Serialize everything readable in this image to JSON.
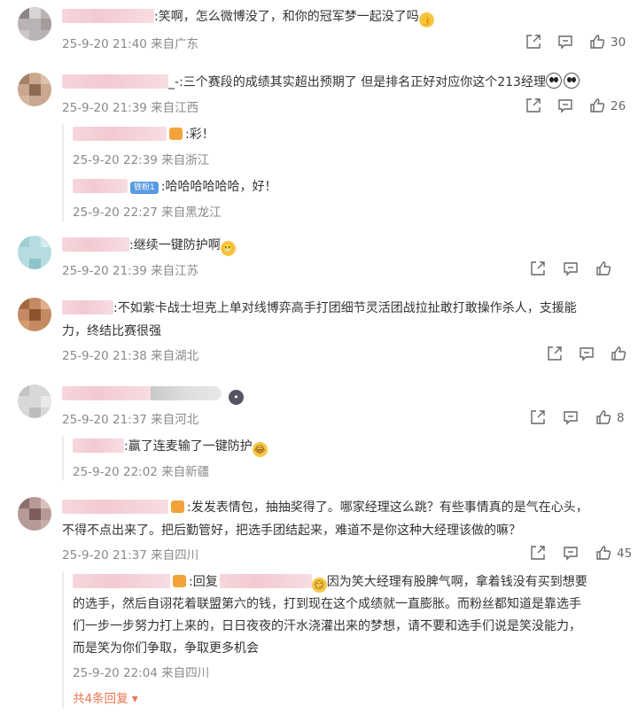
{
  "comments": [
    {
      "text": ":笑啊，怎么微博没了，和你的冠军梦一起没了吗",
      "emoji_icon": "thumbs-up-emoji",
      "meta": "25-9-20 21:40 来自广东",
      "likes": "30"
    },
    {
      "text_prefix": "_-",
      "text": ":三个赛段的成绩其实超出预期了 但是排名正好对应你这个213经理",
      "emoji_icon": "panda-emoji",
      "meta": "25-9-20 21:39 来自江西",
      "likes": "26",
      "replies": [
        {
          "text": ":彩！",
          "meta": "25-9-20 22:39 来自浙江"
        },
        {
          "badge": "铁粉1",
          "text": ":哈哈哈哈哈哈，好！",
          "meta": "25-9-20 22:27 来自黑龙江"
        }
      ]
    },
    {
      "text": ":继续一键防护啊",
      "emoji_icon": "grimace-emoji",
      "meta": "25-9-20 21:39 来自江苏",
      "likes": ""
    },
    {
      "text_line1": ":不如紫卡战士坦克上单对线博弈高手打团细节灵活团战拉扯敢打敢操作杀人，支援能",
      "text_line2": "力，终结比赛很强",
      "meta": "25-9-20 21:38 来自湖北",
      "likes": ""
    },
    {
      "emoji_icon": "sticker-emoji",
      "meta": "25-9-20 21:37 来自河北",
      "likes": "8",
      "replies": [
        {
          "text": ":赢了连麦输了一键防护",
          "meta": "25-9-20 22:02 来自新疆"
        }
      ]
    },
    {
      "text_line1": ":发发表情包，抽抽奖得了。哪家经理这么跳？有些事情真的是气在心头，",
      "text_line2": "不得不点出来了。把后勤管好，把选手团结起来，难道不是你这种大经理该做的嘛？",
      "meta": "25-9-20 21:37 来自四川",
      "likes": "45",
      "replies": [
        {
          "text_reply_prefix": ":回复",
          "text_line1": "因为笑大经理有股脾气啊，拿着钱没有买到想要",
          "text_line2": "的选手，然后自诩花着联盟第六的钱，打到现在这个成绩就一直膨胀。而粉丝都知道是靠选手",
          "text_line3": "们一步一步努力打上来的，日日夜夜的汗水浇灌出来的梦想，请不要和选手们说是笑没能力，",
          "text_line4": "而是笑为你们争取，争取更多机会",
          "meta": "25-9-20 22:04 来自四川"
        }
      ]
    }
  ],
  "more_replies": "共4条回复"
}
